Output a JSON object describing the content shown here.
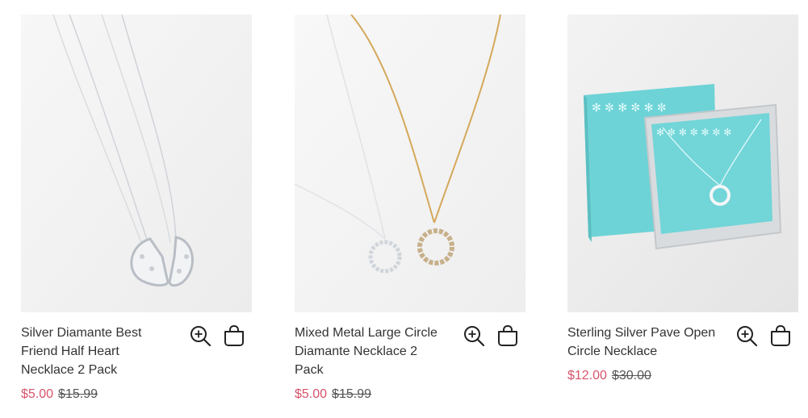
{
  "colors": {
    "sale": "#d9536b",
    "text": "#333333",
    "box": "#6dd3d6",
    "gold": "#d4a85a",
    "silver": "#c8ccd2"
  },
  "products": [
    {
      "title": "Silver Diamante Best Friend Half Heart Necklace 2 Pack",
      "sale_price": "$5.00",
      "original_price": "$15.99",
      "icons": [
        "magnifier-plus-icon",
        "shopping-bag-icon"
      ]
    },
    {
      "title": "Mixed Metal Large Circle Diamante Necklace 2 Pack",
      "sale_price": "$5.00",
      "original_price": "$15.99",
      "icons": [
        "magnifier-plus-icon",
        "shopping-bag-icon"
      ]
    },
    {
      "title": "Sterling Silver Pave Open Circle Necklace",
      "sale_price": "$12.00",
      "original_price": "$30.00",
      "icons": [
        "magnifier-plus-icon",
        "shopping-bag-icon"
      ]
    }
  ]
}
